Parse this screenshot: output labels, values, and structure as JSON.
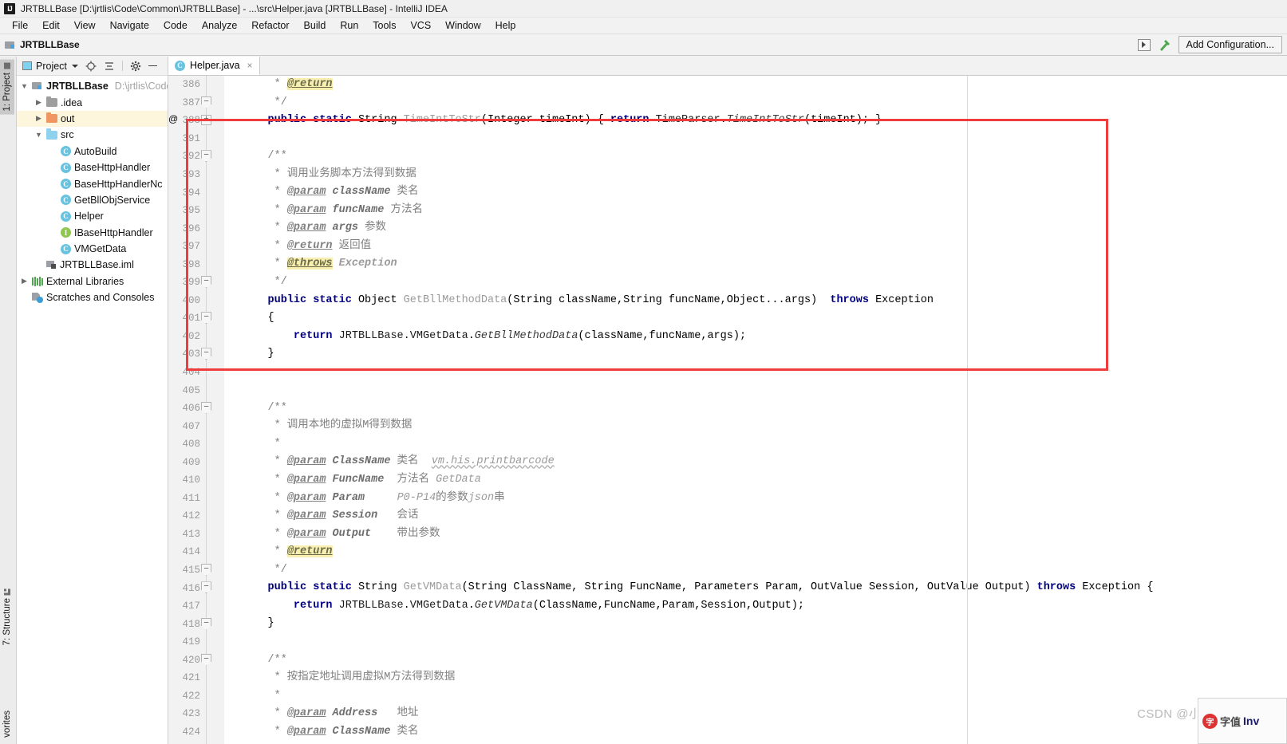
{
  "window": {
    "title": "JRTBLLBase [D:\\jrtlis\\Code\\Common\\JRTBLLBase] - ...\\src\\Helper.java [JRTBLLBase] - IntelliJ IDEA",
    "logo": "IJ"
  },
  "menubar": {
    "items": [
      {
        "label": "File"
      },
      {
        "label": "Edit"
      },
      {
        "label": "View"
      },
      {
        "label": "Navigate"
      },
      {
        "label": "Code"
      },
      {
        "label": "Analyze"
      },
      {
        "label": "Refactor"
      },
      {
        "label": "Build"
      },
      {
        "label": "Run"
      },
      {
        "label": "Tools"
      },
      {
        "label": "VCS"
      },
      {
        "label": "Window"
      },
      {
        "label": "Help"
      }
    ]
  },
  "toolbar": {
    "module_name": "JRTBLLBase",
    "add_configuration_label": "Add Configuration...",
    "run_icon": "run-icon",
    "build_icon": "hammer-icon"
  },
  "left_strip": {
    "project_tab": "1: Project",
    "structure_tab": "7: Structure",
    "favorites_tab": "vorites"
  },
  "project_panel": {
    "header": {
      "title": "Project",
      "icons": [
        "locate-icon",
        "collapse-all-icon",
        "gear-icon",
        "hide-icon"
      ]
    },
    "tree": [
      {
        "label": "JRTBLLBase",
        "path": "D:\\jrtlis\\Code",
        "icon": "module-icon",
        "arrow": "expanded",
        "indent": 0,
        "bold": true,
        "highlight": false
      },
      {
        "label": ".idea",
        "path": "",
        "icon": "folder-gray",
        "arrow": "collapsed",
        "indent": 1,
        "bold": false,
        "highlight": false
      },
      {
        "label": "out",
        "path": "",
        "icon": "folder-orange",
        "arrow": "collapsed",
        "indent": 1,
        "bold": false,
        "highlight": true
      },
      {
        "label": "src",
        "path": "",
        "icon": "folder-blue",
        "arrow": "expanded",
        "indent": 1,
        "bold": false,
        "highlight": false
      },
      {
        "label": "AutoBuild",
        "path": "",
        "icon": "class-icon",
        "arrow": "none",
        "indent": 2,
        "bold": false,
        "highlight": false
      },
      {
        "label": "BaseHttpHandler",
        "path": "",
        "icon": "class-icon",
        "arrow": "none",
        "indent": 2,
        "bold": false,
        "highlight": false
      },
      {
        "label": "BaseHttpHandlerNc",
        "path": "",
        "icon": "class-icon",
        "arrow": "none",
        "indent": 2,
        "bold": false,
        "highlight": false
      },
      {
        "label": "GetBllObjService",
        "path": "",
        "icon": "class-icon",
        "arrow": "none",
        "indent": 2,
        "bold": false,
        "highlight": false
      },
      {
        "label": "Helper",
        "path": "",
        "icon": "class-icon",
        "arrow": "none",
        "indent": 2,
        "bold": false,
        "highlight": false
      },
      {
        "label": "IBaseHttpHandler",
        "path": "",
        "icon": "interface-icon",
        "arrow": "none",
        "indent": 2,
        "bold": false,
        "highlight": false
      },
      {
        "label": "VMGetData",
        "path": "",
        "icon": "class-icon",
        "arrow": "none",
        "indent": 2,
        "bold": false,
        "highlight": false
      },
      {
        "label": "JRTBLLBase.iml",
        "path": "",
        "icon": "iml-icon",
        "arrow": "none",
        "indent": 1,
        "bold": false,
        "highlight": false
      },
      {
        "label": "External Libraries",
        "path": "",
        "icon": "library-icon",
        "arrow": "collapsed",
        "indent": 0,
        "bold": false,
        "highlight": false
      },
      {
        "label": "Scratches and Consoles",
        "path": "",
        "icon": "scratches-icon",
        "arrow": "none",
        "indent": 0,
        "bold": false,
        "highlight": false
      }
    ]
  },
  "editor": {
    "tabs": [
      {
        "label": "Helper.java",
        "icon": "class-icon",
        "close": "×",
        "active": true
      }
    ],
    "line_numbers": [
      386,
      387,
      388,
      391,
      392,
      393,
      394,
      395,
      396,
      397,
      398,
      399,
      400,
      401,
      402,
      403,
      404,
      405,
      406,
      407,
      408,
      409,
      410,
      411,
      412,
      413,
      414,
      415,
      416,
      417,
      418,
      419,
      420,
      421,
      422,
      423,
      424
    ],
    "annotation_gutter": {
      "line": 388,
      "marker": "@"
    },
    "code_lines": [
      "      * @return",
      "      */",
      "     public static String TimeIntToStr(Integer timeInt) { return TimeParser.TimeIntToStr(timeInt); }",
      "",
      "     /**",
      "      * 调用业务脚本方法得到数据",
      "      * @param className 类名",
      "      * @param funcName 方法名",
      "      * @param args 参数",
      "      * @return 返回值",
      "      * @throws Exception",
      "      */",
      "     public static Object GetBllMethodData(String className,String funcName,Object...args)  throws Exception",
      "     {",
      "         return JRTBLLBase.VMGetData.GetBllMethodData(className,funcName,args);",
      "     }",
      "",
      "",
      "     /**",
      "      * 调用本地的虚拟M得到数据",
      "      *",
      "      * @param ClassName 类名  vm.his.printbarcode",
      "      * @param FuncName  方法名 GetData",
      "      * @param Param     P0-P14的参数json串",
      "      * @param Session   会话",
      "      * @param Output    带出参数",
      "      * @return",
      "      */",
      "     public static String GetVMData(String ClassName, String FuncName, Parameters Param, OutValue Session, OutValue Output) throws Exception {",
      "         return JRTBLLBase.VMGetData.GetVMData(ClassName,FuncName,Param,Session,Output);",
      "     }",
      "",
      "     /**",
      "      * 按指定地址调用虚拟M方法得到数据",
      "      *",
      "      * @param Address   地址",
      "      * @param ClassName 类名"
    ]
  },
  "annotation": {
    "type": "red-rectangle",
    "color": "#f03c3c",
    "covers_lines": "391-405"
  },
  "watermark": {
    "text": "CSDN @小与",
    "popup_badge": "字",
    "popup_cn": "字值",
    "popup_inv": "Inv"
  }
}
